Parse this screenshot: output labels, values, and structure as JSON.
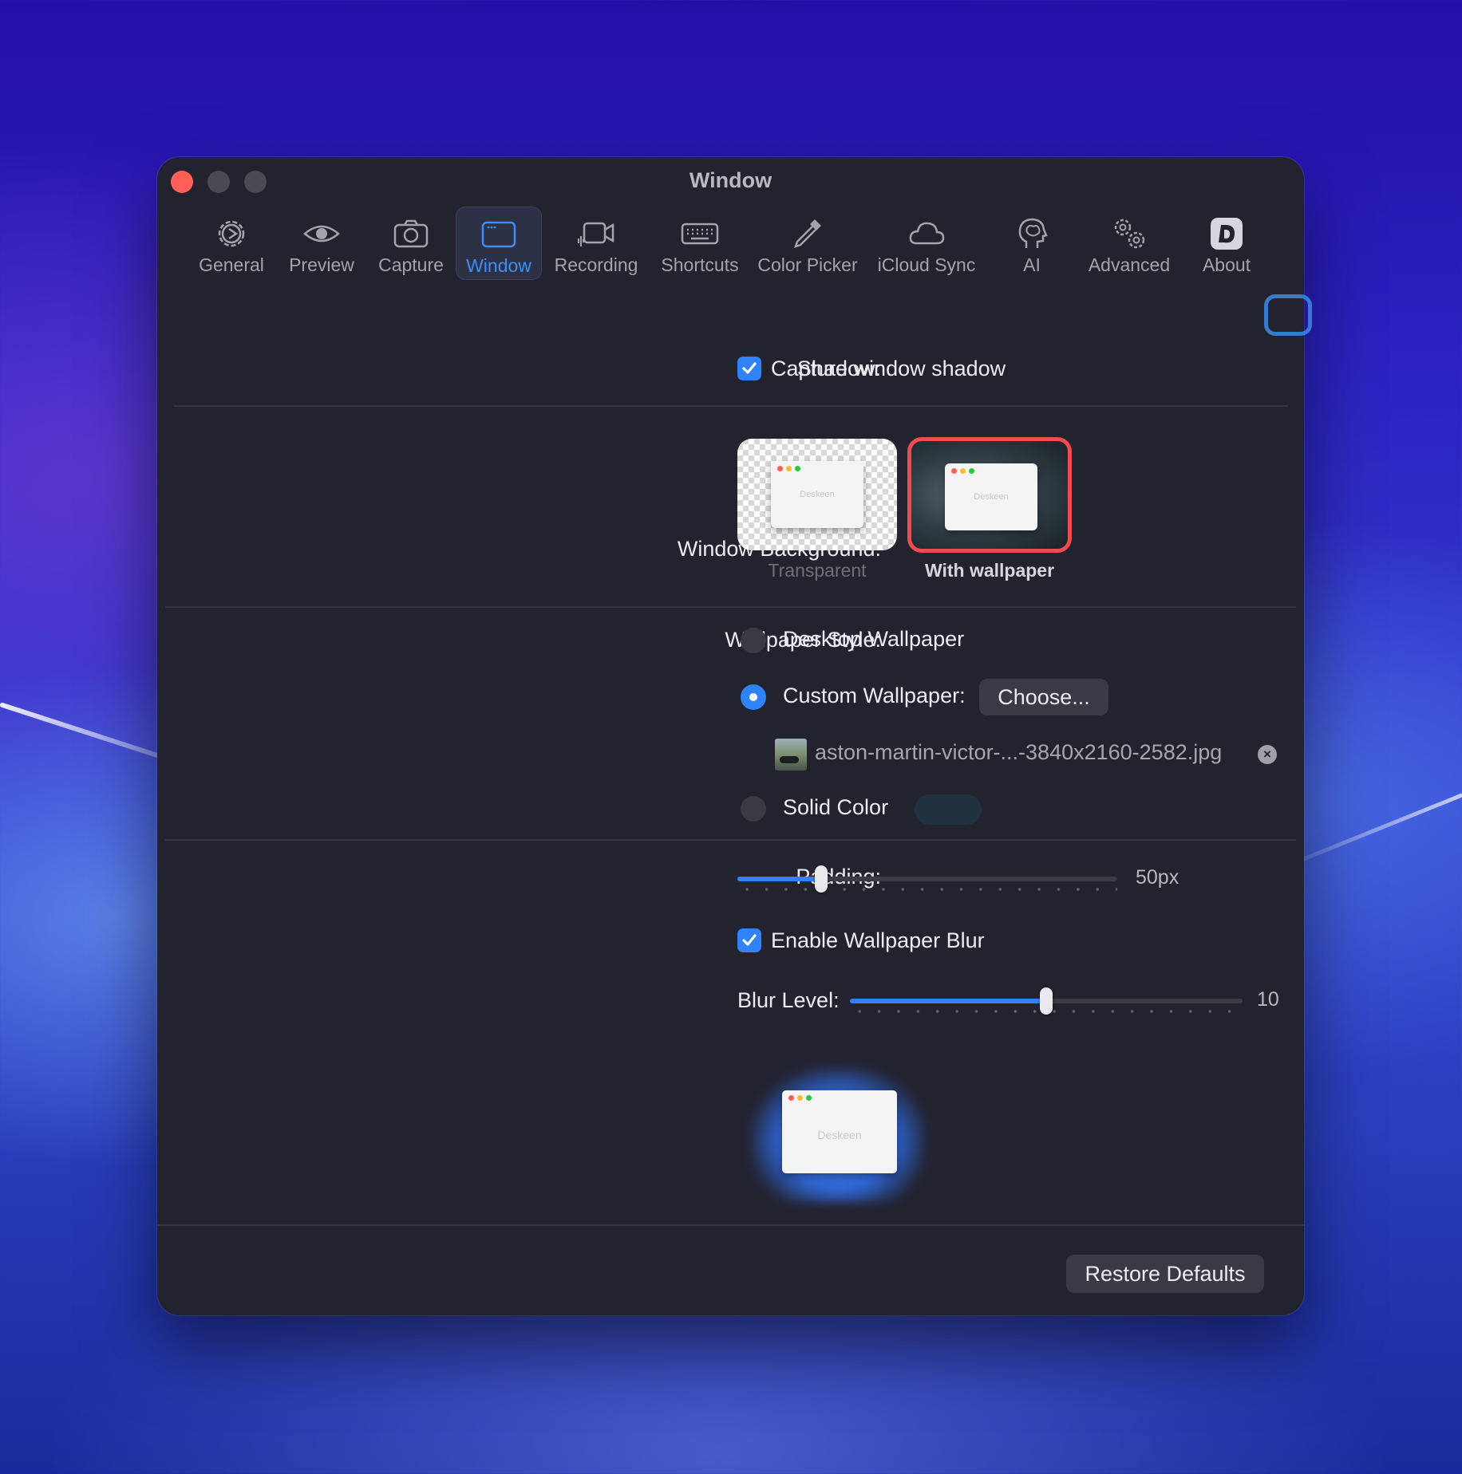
{
  "window": {
    "title": "Window"
  },
  "toolbar": {
    "tabs": [
      {
        "label": "General",
        "icon": "gear-icon"
      },
      {
        "label": "Preview",
        "icon": "eye-icon"
      },
      {
        "label": "Capture",
        "icon": "camera-icon"
      },
      {
        "label": "Window",
        "icon": "window-icon",
        "active": true
      },
      {
        "label": "Recording",
        "icon": "video-camera-icon"
      },
      {
        "label": "Shortcuts",
        "icon": "keyboard-icon"
      },
      {
        "label": "Color Picker",
        "icon": "eyedropper-icon"
      },
      {
        "label": "iCloud Sync",
        "icon": "cloud-icon"
      },
      {
        "label": "AI",
        "icon": "brain-icon"
      },
      {
        "label": "Advanced",
        "icon": "gears-icon"
      },
      {
        "label": "About",
        "icon": "app-logo-icon"
      }
    ]
  },
  "shadow": {
    "label": "Shadow:",
    "checkbox_label": "Capture window shadow",
    "checked": true
  },
  "background": {
    "label": "Window Background:",
    "options": [
      {
        "caption": "Transparent",
        "selected": false,
        "mini_name": "Deskeen"
      },
      {
        "caption": "With wallpaper",
        "selected": true,
        "mini_name": "Deskeen"
      }
    ]
  },
  "wallpaper_style": {
    "label": "Wallpaper Style:",
    "desktop": "Desktop Wallpaper",
    "custom": "Custom Wallpaper:",
    "choose_button": "Choose...",
    "file_name": "aston-martin-victor-...-3840x2160-2582.jpg",
    "solid": "Solid Color",
    "selected": "custom",
    "solid_color": "#20323f"
  },
  "padding": {
    "label": "Padding:",
    "value_text": "50px",
    "fraction": 0.22
  },
  "blur": {
    "checkbox_label": "Enable Wallpaper Blur",
    "checked": true,
    "label": "Blur Level:",
    "value_text": "10",
    "fraction": 0.5
  },
  "preview": {
    "mini_name": "Deskeen"
  },
  "footer": {
    "restore_button": "Restore Defaults"
  },
  "colors": {
    "accent": "#2f82f7",
    "selected_border": "#f04b50",
    "window_bg": "#232330"
  }
}
